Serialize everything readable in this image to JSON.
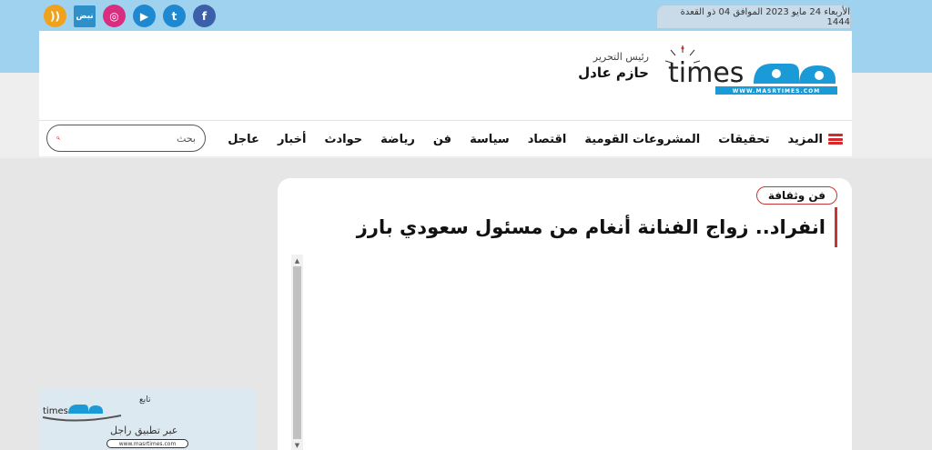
{
  "topbar": {
    "date": "الأربعاء 24 مايو 2023 الموافق 04 ذو القعدة 1444",
    "social": [
      {
        "name": "rss-icon",
        "glyph": "))",
        "color": "#f0a11e"
      },
      {
        "name": "nabd-icon",
        "glyph": "نبض",
        "color": "#2f8fc9"
      },
      {
        "name": "instagram-icon",
        "glyph": "◎",
        "color": "#d92e7f"
      },
      {
        "name": "youtube-icon",
        "glyph": "▶",
        "color": "#1e88d1"
      },
      {
        "name": "twitter-icon",
        "glyph": "t",
        "color": "#1e88d1"
      },
      {
        "name": "facebook-icon",
        "glyph": "f",
        "color": "#3b5fa8"
      }
    ]
  },
  "header": {
    "editor_title": "رئيس التحرير",
    "editor_name": "حازم عادل",
    "logo_word": "times",
    "logo_url": "WWW.MASRTIMES.COM"
  },
  "nav": {
    "items": [
      "عاجل",
      "أخبار",
      "حوادث",
      "رياضة",
      "فن",
      "سياسة",
      "اقتصاد",
      "المشروعات القومية",
      "تحقيقات"
    ],
    "more": "المزيد"
  },
  "search": {
    "placeholder": "بحث"
  },
  "article": {
    "category": "فن وثقافة",
    "title": "انفراد.. زواج الفنانة أنغام من مسئول سعودي بارز"
  },
  "promo": {
    "follow": "تابع",
    "via": "عبر تطبيق راجل",
    "url": "www.masrtimes.com"
  },
  "colors": {
    "accent": "#c73636",
    "topband": "#9fd2ef",
    "logo_blue": "#1a9ad6"
  }
}
